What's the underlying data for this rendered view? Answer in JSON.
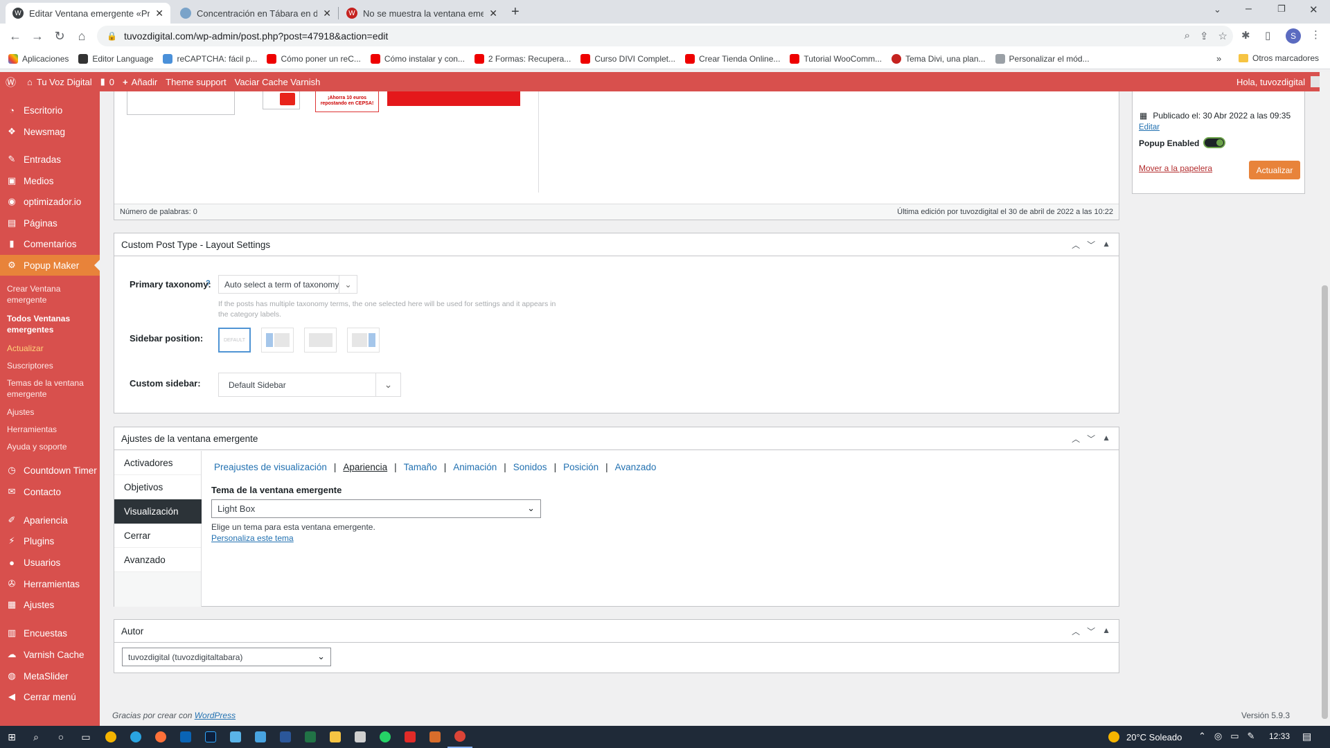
{
  "browser": {
    "tabs": [
      {
        "title": "Editar Ventana emergente «Prue",
        "active": true
      },
      {
        "title": "Concentración en Tábara en defe",
        "active": false
      },
      {
        "title": "No se muestra la ventana emerg",
        "active": false
      }
    ],
    "url": "tuvozdigital.com/wp-admin/post.php?post=47918&action=edit",
    "profile_initial": "S",
    "bookmarks": [
      "Aplicaciones",
      "Editor Language",
      "reCAPTCHA: fácil p...",
      "Cómo poner un reC...",
      "Cómo instalar y con...",
      "2 Formas: Recupera...",
      "Curso DIVI Complet...",
      "Crear Tienda Online...",
      "Tutorial WooComm...",
      "Tema Divi, una plan...",
      "Personalizar el mód..."
    ],
    "more_bookmarks": "»",
    "other_bookmarks": "Otros marcadores"
  },
  "adminbar": {
    "site": "Tu Voz Digital",
    "comments": "0",
    "add": "Añadir",
    "theme_support": "Theme support",
    "varnish": "Vaciar Cache Varnish",
    "greeting": "Hola, tuvozdigital"
  },
  "sidebar": {
    "items": [
      "Escritorio",
      "Newsmag",
      "Entradas",
      "Medios",
      "optimizador.io",
      "Páginas",
      "Comentarios",
      "Popup Maker"
    ],
    "sub": [
      "Crear Ventana emergente",
      "Todos Ventanas emergentes",
      "Actualizar",
      "Suscriptores",
      "Temas de la ventana emergente",
      "Ajustes",
      "Herramientas",
      "Ayuda y soporte"
    ],
    "items2": [
      "Countdown Timer",
      "Contacto",
      "Apariencia",
      "Plugins",
      "Usuarios",
      "Herramientas",
      "Ajustes",
      "Encuestas",
      "Varnish Cache",
      "MetaSlider",
      "Cerrar menú"
    ]
  },
  "editor": {
    "word_count": "Número de palabras: 0",
    "last_edit": "Última edición por tuvozdigital el 30 de abril de 2022 a las 10:22",
    "banner_text": "¡Ahorra 10 euros repostando en CEPSA!"
  },
  "publish": {
    "published": "Publicado el: 30 Abr 2022 a las 09:35",
    "edit": "Editar",
    "popup_enabled": "Popup Enabled",
    "trash": "Mover a la papelera",
    "update": "Actualizar"
  },
  "layout_box": {
    "title": "Custom Post Type - Layout Settings",
    "primary_taxonomy_label": "Primary taxonomy:",
    "help": "?",
    "primary_taxonomy_value": "Auto select a term of taxonomy",
    "taxonomy_help": "If the posts has multiple taxonomy terms, the one selected here will be used for settings and it appears in the category labels.",
    "sidebar_position_label": "Sidebar position:",
    "default_label": "DEFAULT",
    "custom_sidebar_label": "Custom sidebar:",
    "custom_sidebar_value": "Default Sidebar"
  },
  "popup_box": {
    "title": "Ajustes de la ventana emergente",
    "left_tabs": [
      "Activadores",
      "Objetivos",
      "Visualización",
      "Cerrar",
      "Avanzado"
    ],
    "sub_tabs": [
      "Preajustes de visualización",
      "Apariencia",
      "Tamaño",
      "Animación",
      "Sonidos",
      "Posición",
      "Avanzado"
    ],
    "theme_label": "Tema de la ventana emergente",
    "theme_value": "Light Box",
    "theme_help": "Elige un tema para esta ventana emergente.",
    "customize_link": "Personaliza este tema"
  },
  "author_box": {
    "title": "Autor",
    "value": "tuvozdigital (tuvozdigitaltabara)"
  },
  "footer": {
    "thanks": "Gracias por crear con ",
    "wp_link": "WordPress",
    "version": "Versión 5.9.3"
  },
  "taskbar": {
    "weather": "20°C Soleado",
    "time": "12:33"
  }
}
